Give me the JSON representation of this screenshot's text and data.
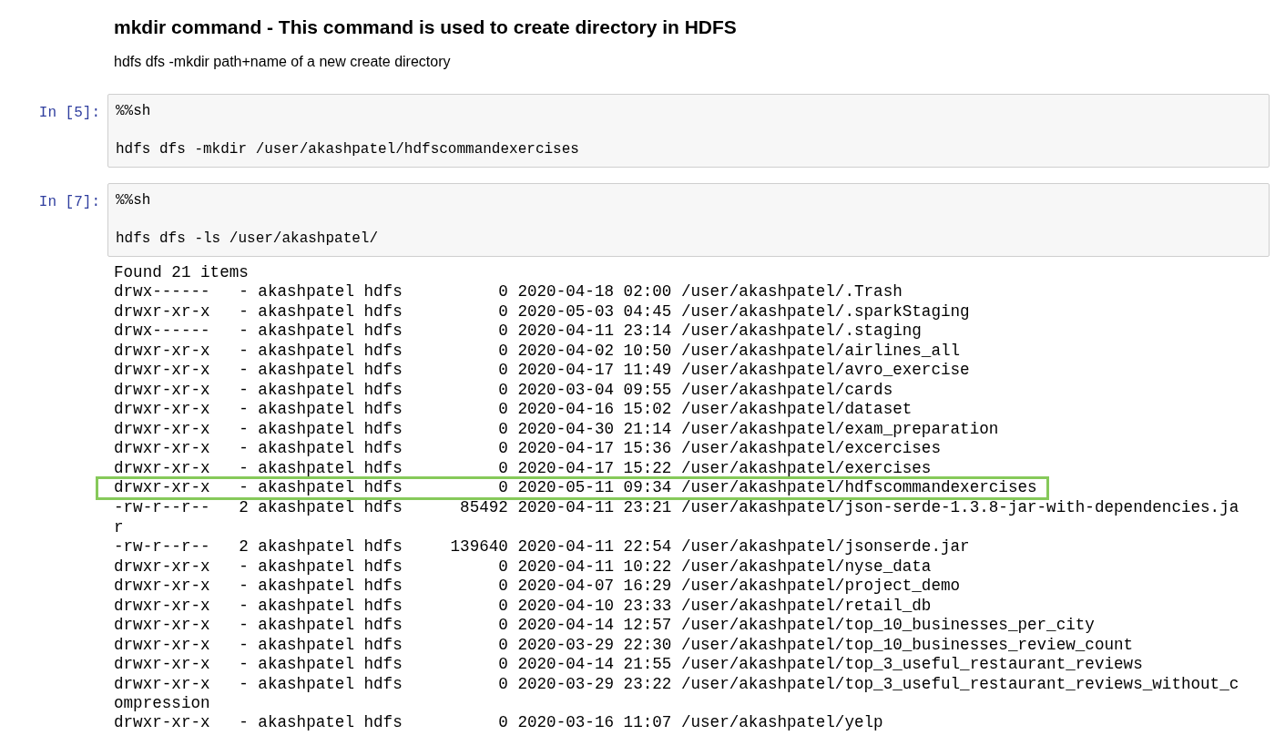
{
  "heading": "mkdir command - This command is used to create directory in HDFS",
  "paragraph": "hdfs dfs -mkdir path+name of a new create directory",
  "cells": [
    {
      "prompt": "In [5]:",
      "source": "%%sh\n\nhdfs dfs -mkdir /user/akashpatel/hdfscommandexercises"
    },
    {
      "prompt": "In [7]:",
      "source": "%%sh\n\nhdfs dfs -ls /user/akashpatel/",
      "output": [
        {
          "text": "Found 21 items",
          "highlighted": false
        },
        {
          "text": "drwx------   - akashpatel hdfs          0 2020-04-18 02:00 /user/akashpatel/.Trash",
          "highlighted": false
        },
        {
          "text": "drwxr-xr-x   - akashpatel hdfs          0 2020-05-03 04:45 /user/akashpatel/.sparkStaging",
          "highlighted": false
        },
        {
          "text": "drwx------   - akashpatel hdfs          0 2020-04-11 23:14 /user/akashpatel/.staging",
          "highlighted": false
        },
        {
          "text": "drwxr-xr-x   - akashpatel hdfs          0 2020-04-02 10:50 /user/akashpatel/airlines_all",
          "highlighted": false
        },
        {
          "text": "drwxr-xr-x   - akashpatel hdfs          0 2020-04-17 11:49 /user/akashpatel/avro_exercise",
          "highlighted": false
        },
        {
          "text": "drwxr-xr-x   - akashpatel hdfs          0 2020-03-04 09:55 /user/akashpatel/cards",
          "highlighted": false
        },
        {
          "text": "drwxr-xr-x   - akashpatel hdfs          0 2020-04-16 15:02 /user/akashpatel/dataset",
          "highlighted": false
        },
        {
          "text": "drwxr-xr-x   - akashpatel hdfs          0 2020-04-30 21:14 /user/akashpatel/exam_preparation",
          "highlighted": false
        },
        {
          "text": "drwxr-xr-x   - akashpatel hdfs          0 2020-04-17 15:36 /user/akashpatel/excercises",
          "highlighted": false
        },
        {
          "text": "drwxr-xr-x   - akashpatel hdfs          0 2020-04-17 15:22 /user/akashpatel/exercises",
          "highlighted": false
        },
        {
          "text": "drwxr-xr-x   - akashpatel hdfs          0 2020-05-11 09:34 /user/akashpatel/hdfscommandexercises",
          "highlighted": true
        },
        {
          "text": "-rw-r--r--   2 akashpatel hdfs      85492 2020-04-11 23:21 /user/akashpatel/json-serde-1.3.8-jar-with-dependencies.ja",
          "highlighted": false
        },
        {
          "text": "r",
          "highlighted": false
        },
        {
          "text": "-rw-r--r--   2 akashpatel hdfs     139640 2020-04-11 22:54 /user/akashpatel/jsonserde.jar",
          "highlighted": false
        },
        {
          "text": "drwxr-xr-x   - akashpatel hdfs          0 2020-04-11 10:22 /user/akashpatel/nyse_data",
          "highlighted": false
        },
        {
          "text": "drwxr-xr-x   - akashpatel hdfs          0 2020-04-07 16:29 /user/akashpatel/project_demo",
          "highlighted": false
        },
        {
          "text": "drwxr-xr-x   - akashpatel hdfs          0 2020-04-10 23:33 /user/akashpatel/retail_db",
          "highlighted": false
        },
        {
          "text": "drwxr-xr-x   - akashpatel hdfs          0 2020-04-14 12:57 /user/akashpatel/top_10_businesses_per_city",
          "highlighted": false
        },
        {
          "text": "drwxr-xr-x   - akashpatel hdfs          0 2020-03-29 22:30 /user/akashpatel/top_10_businesses_review_count",
          "highlighted": false
        },
        {
          "text": "drwxr-xr-x   - akashpatel hdfs          0 2020-04-14 21:55 /user/akashpatel/top_3_useful_restaurant_reviews",
          "highlighted": false
        },
        {
          "text": "drwxr-xr-x   - akashpatel hdfs          0 2020-03-29 23:22 /user/akashpatel/top_3_useful_restaurant_reviews_without_c",
          "highlighted": false
        },
        {
          "text": "ompression",
          "highlighted": false
        },
        {
          "text": "drwxr-xr-x   - akashpatel hdfs          0 2020-03-16 11:07 /user/akashpatel/yelp",
          "highlighted": false
        }
      ]
    }
  ]
}
